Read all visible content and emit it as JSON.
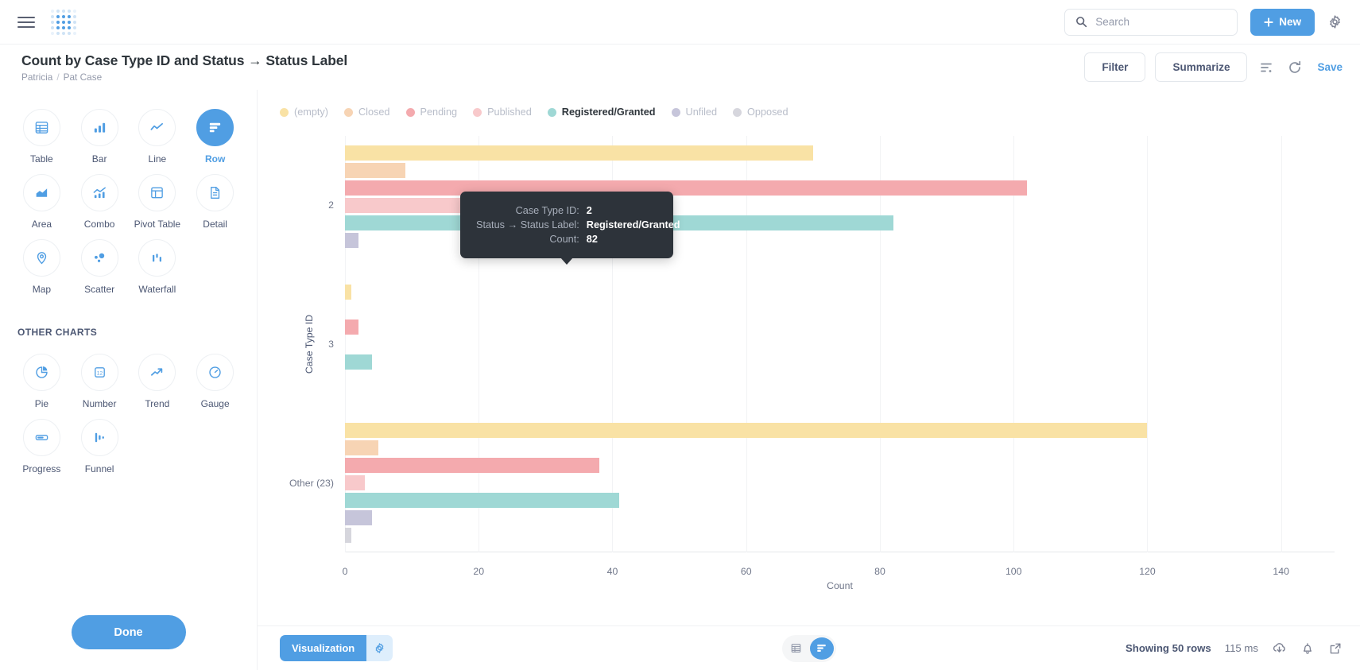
{
  "topnav": {
    "menu_icon": "hamburger-icon",
    "logo_icon": "metabase-logo",
    "search_placeholder": "Search",
    "new_label": "New",
    "settings_icon": "gear-icon"
  },
  "question": {
    "title": "Count by Case Type ID and Status → Status Label",
    "breadcrumb_collection": "Patricia",
    "breadcrumb_separator": "/",
    "breadcrumb_table": "Pat Case",
    "filter_label": "Filter",
    "summarize_label": "Summarize",
    "editor_icon": "notebook-icon",
    "refresh_icon": "refresh-icon",
    "save_label": "Save"
  },
  "viz_sidebar": {
    "charts": [
      {
        "label": "Table",
        "icon": "table-icon",
        "active": false
      },
      {
        "label": "Bar",
        "icon": "bar-chart-icon",
        "active": false
      },
      {
        "label": "Line",
        "icon": "line-chart-icon",
        "active": false
      },
      {
        "label": "Row",
        "icon": "row-chart-icon",
        "active": true
      },
      {
        "label": "Area",
        "icon": "area-chart-icon",
        "active": false
      },
      {
        "label": "Combo",
        "icon": "combo-chart-icon",
        "active": false
      },
      {
        "label": "Pivot Table",
        "icon": "pivot-table-icon",
        "active": false
      },
      {
        "label": "Detail",
        "icon": "detail-document-icon",
        "active": false
      },
      {
        "label": "Map",
        "icon": "map-pin-icon",
        "active": false
      },
      {
        "label": "Scatter",
        "icon": "scatter-plot-icon",
        "active": false
      },
      {
        "label": "Waterfall",
        "icon": "waterfall-chart-icon",
        "active": false
      }
    ],
    "other_charts_heading": "OTHER CHARTS",
    "other_charts": [
      {
        "label": "Pie",
        "icon": "pie-chart-icon",
        "active": false
      },
      {
        "label": "Number",
        "icon": "number-icon",
        "active": false
      },
      {
        "label": "Trend",
        "icon": "trend-arrow-icon",
        "active": false
      },
      {
        "label": "Gauge",
        "icon": "gauge-icon",
        "active": false
      },
      {
        "label": "Progress",
        "icon": "progress-bar-icon",
        "active": false
      },
      {
        "label": "Funnel",
        "icon": "funnel-icon",
        "active": false
      }
    ],
    "done_label": "Done"
  },
  "tooltip": {
    "rows": [
      {
        "key": "Case Type ID:",
        "value": "2"
      },
      {
        "key": "Status → Status Label:",
        "value": "Registered/Granted"
      },
      {
        "key": "Count:",
        "value": "82"
      }
    ]
  },
  "bottombar": {
    "visualization_label": "Visualization",
    "settings_icon": "gear-icon",
    "table_view_icon": "table-icon",
    "chart_view_icon": "row-chart-icon",
    "rows_text": "Showing 50 rows",
    "duration_text": "115 ms",
    "download_icon": "download-cloud-icon",
    "alert_icon": "bell-icon",
    "share_icon": "external-link-icon"
  },
  "colors": {
    "brand": "#509ee3",
    "empty": "#f9e2a5",
    "closed": "#f7d4b4",
    "pending": "#f4aaae",
    "published": "#f8c9cb",
    "registered_granted": "#9fd8d5",
    "unfiled": "#c6c5da",
    "opposed": "#d6d6dd"
  },
  "chart_data": {
    "type": "bar",
    "orientation": "horizontal",
    "title": "Count by Case Type ID and Status → Status Label",
    "xlabel": "Count",
    "ylabel": "Case Type ID",
    "xlim": [
      0,
      148
    ],
    "xticks": [
      0,
      20,
      40,
      60,
      80,
      100,
      120,
      140
    ],
    "grid": true,
    "legend_position": "top",
    "legend": [
      "(empty)",
      "Closed",
      "Pending",
      "Published",
      "Registered/Granted",
      "Unfiled",
      "Opposed"
    ],
    "highlighted_series": "Registered/Granted",
    "categories": [
      "2",
      "3",
      "Other (23)"
    ],
    "series": [
      {
        "name": "(empty)",
        "color": "#f9e2a5",
        "values": [
          70,
          1,
          120
        ]
      },
      {
        "name": "Closed",
        "color": "#f7d4b4",
        "values": [
          9,
          0,
          5
        ]
      },
      {
        "name": "Pending",
        "color": "#f4aaae",
        "values": [
          102,
          2,
          38
        ]
      },
      {
        "name": "Published",
        "color": "#f8c9cb",
        "values": [
          20,
          0,
          3
        ]
      },
      {
        "name": "Registered/Granted",
        "color": "#9fd8d5",
        "values": [
          82,
          4,
          41
        ]
      },
      {
        "name": "Unfiled",
        "color": "#c6c5da",
        "values": [
          2,
          0,
          4
        ]
      },
      {
        "name": "Opposed",
        "color": "#d6d6dd",
        "values": [
          0,
          0,
          1
        ]
      }
    ]
  }
}
